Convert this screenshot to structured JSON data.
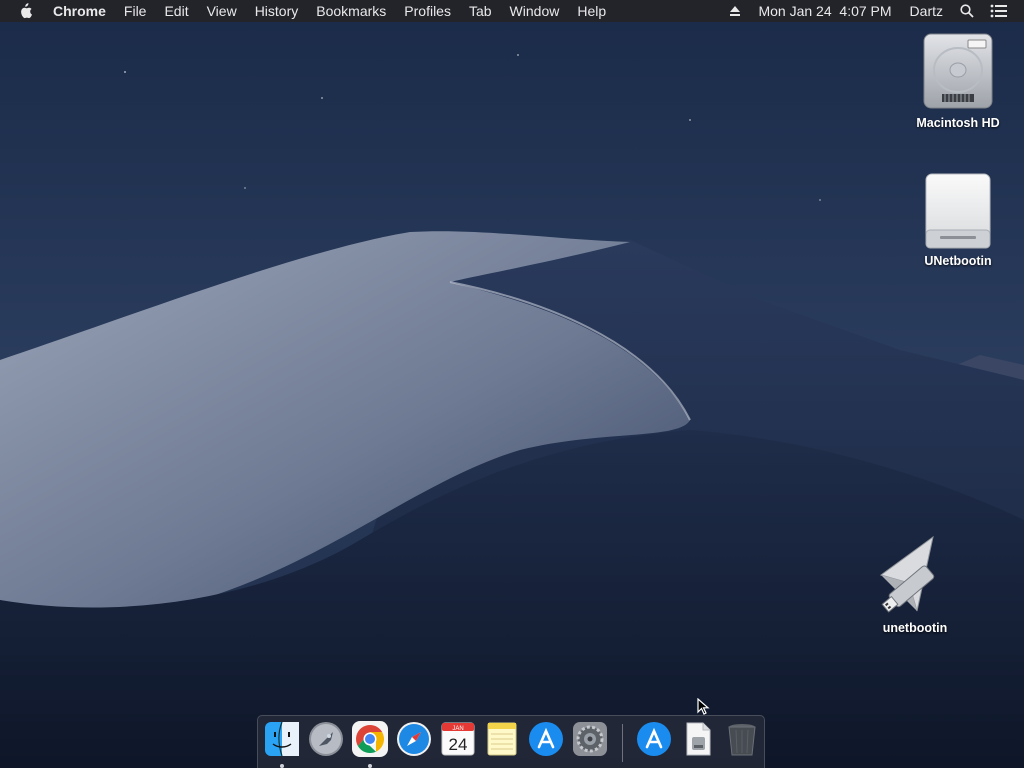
{
  "menubar": {
    "app_name": "Chrome",
    "menus": [
      "File",
      "Edit",
      "View",
      "History",
      "Bookmarks",
      "Profiles",
      "Tab",
      "Window",
      "Help"
    ],
    "clock": "Mon Jan 24  4:07 PM",
    "user": "Dartz",
    "icons": [
      "apple-logo-icon",
      "eject-icon",
      "spotlight-search-icon",
      "notification-center-icon"
    ]
  },
  "desktop": {
    "icons": [
      {
        "label": "Macintosh HD",
        "icon": "hard-drive-icon"
      },
      {
        "label": "UNetbootin",
        "icon": "external-drive-icon"
      },
      {
        "label": "unetbootin",
        "icon": "usb-app-icon"
      }
    ]
  },
  "dock": {
    "calendar_month": "JAN",
    "calendar_day": "24",
    "items": [
      {
        "icon": "finder-icon",
        "running": true
      },
      {
        "icon": "launchpad-icon",
        "running": false
      },
      {
        "icon": "chrome-icon",
        "running": true
      },
      {
        "icon": "safari-icon",
        "running": false
      },
      {
        "icon": "calendar-icon",
        "running": false
      },
      {
        "icon": "notes-icon",
        "running": false
      },
      {
        "icon": "app-store-icon",
        "running": false
      },
      {
        "icon": "system-preferences-icon",
        "running": false
      },
      {
        "icon": "app-store-downloads-icon",
        "running": false
      },
      {
        "icon": "document-file-icon",
        "running": false
      },
      {
        "icon": "trash-icon",
        "running": false
      }
    ]
  }
}
